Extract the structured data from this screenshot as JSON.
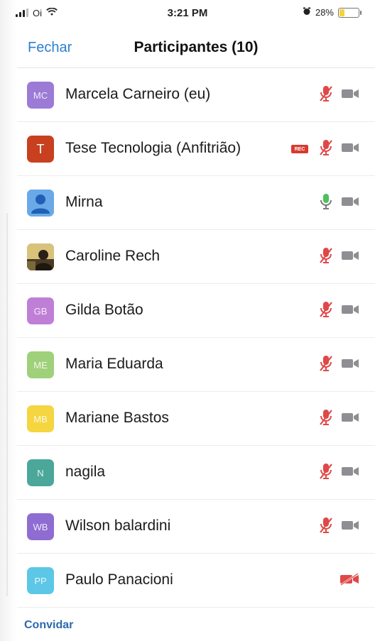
{
  "status_bar": {
    "carrier": "Oi",
    "time": "3:21 PM",
    "battery_percent": "28%",
    "battery_level": 0.28
  },
  "nav": {
    "close_label": "Fechar",
    "title": "Participantes (10)"
  },
  "participants": [
    {
      "initials": "MC",
      "name": "Marcela Carneiro (eu)",
      "avatar_color": "#9b7bd6",
      "mic": "muted",
      "recording": false,
      "video": "on"
    },
    {
      "initials": "T",
      "name": "Tese Tecnologia (Anfitrião)",
      "avatar_color": "#c8401f",
      "mic": "muted",
      "recording": true,
      "recording_label": "REC",
      "video": "on"
    },
    {
      "initials": "",
      "name": "Mirna",
      "avatar_color": "#6aa9e8",
      "avatar_type": "person-icon",
      "mic": "active",
      "recording": false,
      "video": "on"
    },
    {
      "initials": "",
      "name": "Caroline Rech",
      "avatar_color": "#6a5a3a",
      "avatar_type": "photo",
      "mic": "muted",
      "recording": false,
      "video": "on"
    },
    {
      "initials": "GB",
      "name": "Gilda Botão",
      "avatar_color": "#c07fd6",
      "mic": "muted",
      "recording": false,
      "video": "on"
    },
    {
      "initials": "ME",
      "name": "Maria Eduarda",
      "avatar_color": "#9fd07a",
      "mic": "muted",
      "recording": false,
      "video": "on"
    },
    {
      "initials": "MB",
      "name": "Mariane Bastos",
      "avatar_color": "#f5d540",
      "mic": "muted",
      "recording": false,
      "video": "on"
    },
    {
      "initials": "N",
      "name": "nagila",
      "avatar_color": "#4ba79a",
      "mic": "muted",
      "recording": false,
      "video": "on"
    },
    {
      "initials": "WB",
      "name": "Wilson balardini",
      "avatar_color": "#8f6cd1",
      "mic": "muted",
      "recording": false,
      "video": "on"
    },
    {
      "initials": "PP",
      "name": "Paulo Panacioni",
      "avatar_color": "#5cc7e6",
      "mic": "none",
      "recording": false,
      "video": "off"
    }
  ],
  "footer": {
    "invite_label": "Convidar"
  },
  "colors": {
    "accent": "#2d7fcf",
    "muted_mic": "#e04848",
    "active_mic": "#4cc05b",
    "camera": "#8e8e93"
  }
}
